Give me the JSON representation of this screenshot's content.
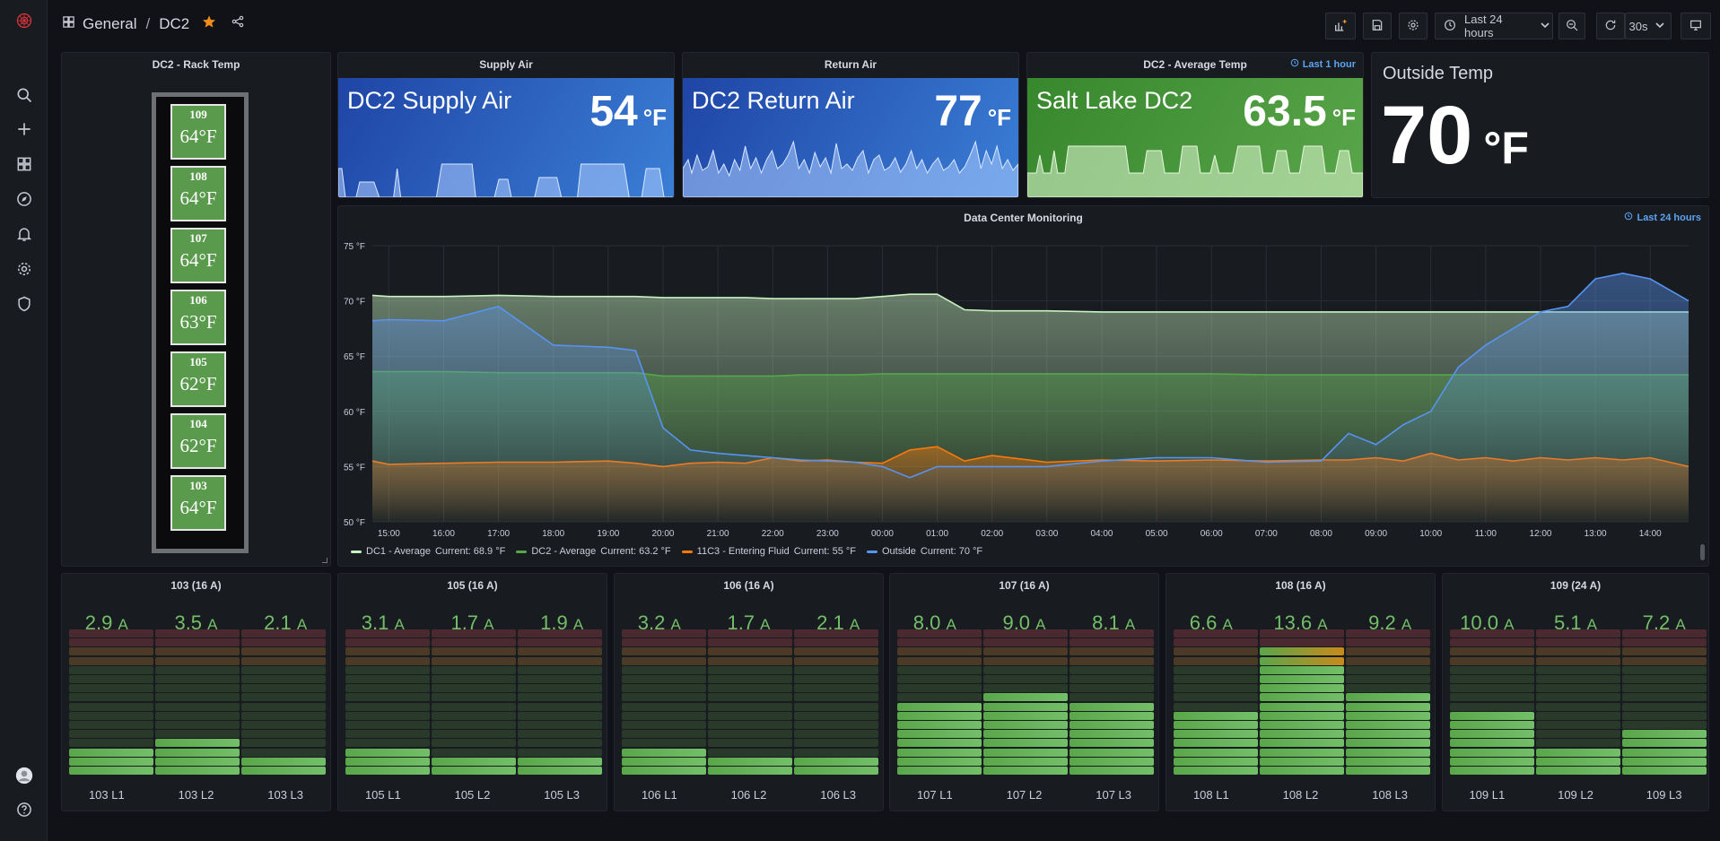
{
  "breadcrumb": {
    "folder": "General",
    "separator": "/",
    "dashboard": "DC2"
  },
  "toolbar": {
    "time_range": "Last 24 hours",
    "refresh": "30s"
  },
  "rack_panel": {
    "title": "DC2 - Rack Temp",
    "units": [
      {
        "num": "109",
        "temp": "64°F"
      },
      {
        "num": "108",
        "temp": "64°F"
      },
      {
        "num": "107",
        "temp": "64°F"
      },
      {
        "num": "106",
        "temp": "63°F"
      },
      {
        "num": "105",
        "temp": "62°F"
      },
      {
        "num": "104",
        "temp": "62°F"
      },
      {
        "num": "103",
        "temp": "64°F"
      }
    ]
  },
  "stats": {
    "supply": {
      "title": "Supply Air",
      "name": "DC2 Supply Air",
      "value": "54",
      "unit": "°F"
    },
    "return": {
      "title": "Return Air",
      "name": "DC2 Return Air",
      "value": "77",
      "unit": "°F"
    },
    "average": {
      "title": "DC2 - Average Temp",
      "badge": "Last 1 hour",
      "name": "Salt Lake DC2",
      "value": "63.5",
      "unit": "°F"
    },
    "outside": {
      "name": "Outside Temp",
      "value": "70",
      "unit": "°F"
    }
  },
  "graph": {
    "title": "Data Center Monitoring",
    "badge": "Last 24 hours",
    "legend": [
      {
        "name": "DC1 - Average",
        "current": "Current: 68.9 °F",
        "color": "#c8f2c2"
      },
      {
        "name": "DC2 - Average",
        "current": "Current: 63.2 °F",
        "color": "#56a64b"
      },
      {
        "name": "11C3 - Entering Fluid",
        "current": "Current: 55 °F",
        "color": "#ff780a"
      },
      {
        "name": "Outside",
        "current": "Current: 70 °F",
        "color": "#5794f2"
      }
    ]
  },
  "chart_data": {
    "type": "line",
    "title": "Data Center Monitoring",
    "ylim": [
      50,
      75
    ],
    "yticks": [
      "50 °F",
      "55 °F",
      "60 °F",
      "65 °F",
      "70 °F",
      "75 °F"
    ],
    "xticks": [
      "15:00",
      "16:00",
      "17:00",
      "18:00",
      "19:00",
      "20:00",
      "21:00",
      "22:00",
      "23:00",
      "00:00",
      "01:00",
      "02:00",
      "03:00",
      "04:00",
      "05:00",
      "06:00",
      "07:00",
      "08:00",
      "09:00",
      "10:00",
      "11:00",
      "12:00",
      "13:00",
      "14:00"
    ],
    "hours": [
      14.7,
      15,
      16,
      17,
      18,
      19,
      19.5,
      20,
      20.5,
      21,
      21.5,
      22,
      22.5,
      23,
      23.5,
      0,
      0.5,
      1,
      1.5,
      2,
      3,
      4,
      5,
      6,
      7,
      8,
      8.5,
      9,
      9.5,
      10,
      10.5,
      11,
      11.5,
      12,
      12.5,
      13,
      13.5,
      14,
      14.6
    ],
    "series": [
      {
        "name": "DC1 - Average",
        "values": [
          70.5,
          70.4,
          70.4,
          70.5,
          70.4,
          70.4,
          70.4,
          70.3,
          70.3,
          70.3,
          70.3,
          70.2,
          70.2,
          70.2,
          70.2,
          70.4,
          70.6,
          70.6,
          69.2,
          69.1,
          69.1,
          69.0,
          69.0,
          69.0,
          69.0,
          69.0,
          69.0,
          69.0,
          69.0,
          69.0,
          69.0,
          69.0,
          69.0,
          69.0,
          69.0,
          69.0,
          69.0,
          69.0,
          69.0
        ]
      },
      {
        "name": "DC2 - Average",
        "values": [
          63.6,
          63.6,
          63.6,
          63.5,
          63.5,
          63.5,
          63.5,
          63.2,
          63.2,
          63.2,
          63.2,
          63.2,
          63.3,
          63.3,
          63.3,
          63.4,
          63.4,
          63.4,
          63.4,
          63.4,
          63.4,
          63.4,
          63.4,
          63.4,
          63.3,
          63.3,
          63.3,
          63.3,
          63.3,
          63.3,
          63.3,
          63.3,
          63.3,
          63.3,
          63.3,
          63.3,
          63.3,
          63.3,
          63.3
        ]
      },
      {
        "name": "11C3 - Entering Fluid",
        "values": [
          55.5,
          55.2,
          55.3,
          55.4,
          55.4,
          55.5,
          55.3,
          55.0,
          55.3,
          55.4,
          55.3,
          55.8,
          55.5,
          55.6,
          55.4,
          55.3,
          56.5,
          56.8,
          55.5,
          56.0,
          55.4,
          55.6,
          55.5,
          55.6,
          55.5,
          55.6,
          55.6,
          55.8,
          55.5,
          56.2,
          55.6,
          55.8,
          55.5,
          55.8,
          55.6,
          55.8,
          55.6,
          55.8,
          55.0
        ]
      },
      {
        "name": "Outside",
        "values": [
          68.2,
          68.3,
          68.2,
          69.5,
          66.0,
          65.8,
          65.5,
          58.5,
          56.5,
          56.2,
          56.0,
          55.8,
          55.6,
          55.5,
          55.4,
          55.0,
          54.0,
          55.0,
          55.0,
          55.0,
          55.0,
          55.5,
          55.8,
          55.8,
          55.4,
          55.5,
          58.0,
          57.0,
          58.8,
          60.0,
          64.0,
          66.0,
          67.5,
          69.0,
          69.5,
          72.0,
          72.5,
          72.0,
          70.0
        ]
      }
    ]
  },
  "bar_gauges": [
    {
      "title": "103 (16 A)",
      "items": [
        {
          "label": "103 L1",
          "value": "2.9",
          "amps": 2.9
        },
        {
          "label": "103 L2",
          "value": "3.5",
          "amps": 3.5
        },
        {
          "label": "103 L3",
          "value": "2.1",
          "amps": 2.1
        }
      ],
      "max": 16
    },
    {
      "title": "105 (16 A)",
      "items": [
        {
          "label": "105 L1",
          "value": "3.1",
          "amps": 3.1
        },
        {
          "label": "105 L2",
          "value": "1.7",
          "amps": 1.7
        },
        {
          "label": "105 L3",
          "value": "1.9",
          "amps": 1.9
        }
      ],
      "max": 16
    },
    {
      "title": "106 (16 A)",
      "items": [
        {
          "label": "106 L1",
          "value": "3.2",
          "amps": 3.2
        },
        {
          "label": "106 L2",
          "value": "1.7",
          "amps": 1.7
        },
        {
          "label": "106 L3",
          "value": "2.1",
          "amps": 2.1
        }
      ],
      "max": 16
    },
    {
      "title": "107 (16 A)",
      "items": [
        {
          "label": "107 L1",
          "value": "8.0",
          "amps": 8.0
        },
        {
          "label": "107 L2",
          "value": "9.0",
          "amps": 9.0
        },
        {
          "label": "107 L3",
          "value": "8.1",
          "amps": 8.1
        }
      ],
      "max": 16
    },
    {
      "title": "108 (16 A)",
      "items": [
        {
          "label": "108 L1",
          "value": "6.6",
          "amps": 6.6
        },
        {
          "label": "108 L2",
          "value": "13.6",
          "amps": 13.6
        },
        {
          "label": "108 L3",
          "value": "9.2",
          "amps": 9.2
        }
      ],
      "max": 16
    },
    {
      "title": "109 (24 A)",
      "items": [
        {
          "label": "109 L1",
          "value": "10.0",
          "amps": 10.0
        },
        {
          "label": "109 L2",
          "value": "5.1",
          "amps": 5.1
        },
        {
          "label": "109 L3",
          "value": "7.2",
          "amps": 7.2
        }
      ],
      "max": 24
    }
  ],
  "gauge_unit": "A"
}
